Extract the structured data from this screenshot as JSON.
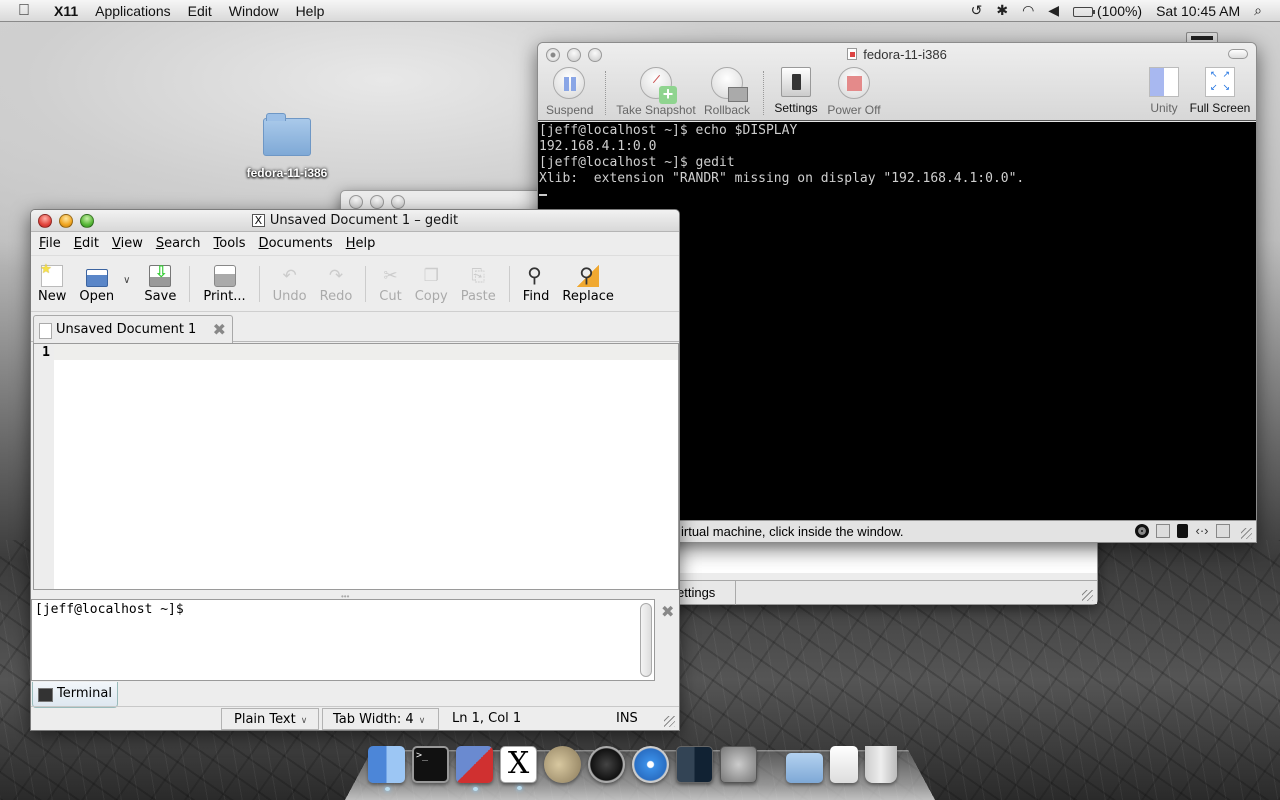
{
  "menubar": {
    "app_name": "X11",
    "items": [
      "Applications",
      "Edit",
      "Window",
      "Help"
    ],
    "status_icons": [
      "time-machine-icon",
      "bluetooth-icon",
      "wifi-icon",
      "volume-icon",
      "battery-icon"
    ],
    "battery": "(100%)",
    "clock": "Sat 10:45 AM"
  },
  "desktop": {
    "icon_label": "fedora-11-i386"
  },
  "bg_window": {
    "status_text": "ettings"
  },
  "vmware": {
    "title": "fedora-11-i386",
    "toolbar": {
      "suspend": "Suspend",
      "take_snapshot": "Take Snapshot",
      "rollback": "Rollback",
      "settings": "Settings",
      "power_off": "Power Off",
      "unity": "Unity",
      "full_screen": "Full Screen"
    },
    "console_lines": [
      "[jeff@localhost ~]$ echo $DISPLAY",
      "192.168.4.1:0.0",
      "[jeff@localhost ~]$ gedit",
      "Xlib:  extension \"RANDR\" missing on display \"192.168.4.1:0.0\"."
    ],
    "status_message": "irtual machine, click inside the window."
  },
  "gedit": {
    "title": "Unsaved Document 1 – gedit",
    "menu": [
      "File",
      "Edit",
      "View",
      "Search",
      "Tools",
      "Documents",
      "Help"
    ],
    "toolbar": {
      "new": "New",
      "open": "Open",
      "save": "Save",
      "print": "Print...",
      "undo": "Undo",
      "redo": "Redo",
      "cut": "Cut",
      "copy": "Copy",
      "paste": "Paste",
      "find": "Find",
      "replace": "Replace"
    },
    "tab_label": "Unsaved Document 1",
    "line_number": "1",
    "terminal_prompt": "[jeff@localhost ~]$",
    "bottom_tab": "Terminal",
    "status": {
      "language": "Plain Text",
      "tab_width": "Tab Width:  4",
      "position": "Ln 1, Col 1",
      "mode": "INS"
    }
  },
  "dock": {
    "apps": [
      "Finder",
      "Terminal",
      "VMware Fusion",
      "X11",
      "GIMP",
      "Dashboard",
      "Safari",
      "Spaces",
      "System Preferences",
      "Documents",
      "Document",
      "Trash"
    ]
  }
}
